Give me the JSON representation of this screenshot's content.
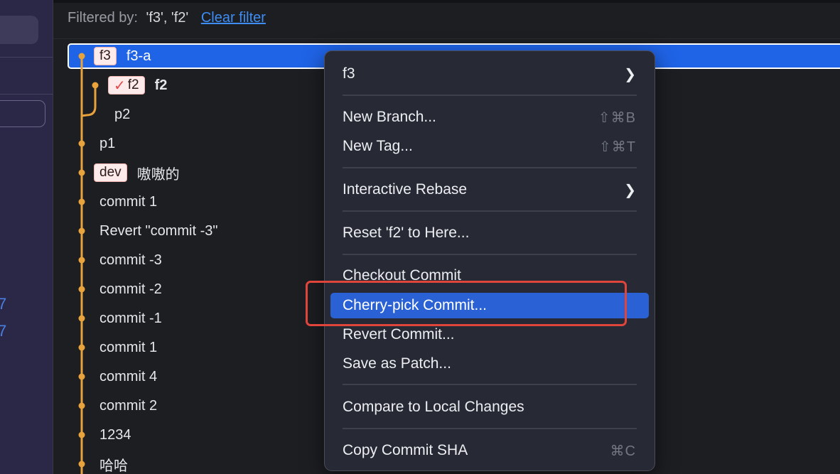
{
  "filter": {
    "label": "Filtered by:",
    "values": "'f3', 'f2'",
    "clear_label": "Clear filter"
  },
  "commits": [
    {
      "tag": "f3",
      "message": "f3-a",
      "selected": true
    },
    {
      "tag": "f2",
      "tag_checked": true,
      "message": "f2",
      "bold": true
    },
    {
      "message": "p2"
    },
    {
      "message": "p1"
    },
    {
      "tag": "dev",
      "message": "嗷嗷的"
    },
    {
      "message": "commit 1"
    },
    {
      "message": "Revert \"commit -3\""
    },
    {
      "message": "commit -3"
    },
    {
      "message": "commit -2"
    },
    {
      "message": "commit -1"
    },
    {
      "message": "commit 1"
    },
    {
      "message": "commit 4"
    },
    {
      "message": "commit 2"
    },
    {
      "message": "1234"
    },
    {
      "message": "哈哈"
    }
  ],
  "sidebar_glyphs": [
    "7",
    "7"
  ],
  "context_menu": {
    "items": [
      {
        "label": "f3",
        "submenu": true
      },
      {
        "label": "New Branch...",
        "shortcut": "⇧⌘B"
      },
      {
        "label": "New Tag...",
        "shortcut": "⇧⌘T"
      },
      {
        "label": "Interactive Rebase",
        "submenu": true
      },
      {
        "label": "Reset 'f2' to Here..."
      },
      {
        "label": "Checkout Commit"
      },
      {
        "label": "Cherry-pick Commit...",
        "highlighted": true
      },
      {
        "label": "Revert Commit..."
      },
      {
        "label": "Save as Patch..."
      },
      {
        "label": "Compare to Local Changes"
      },
      {
        "label": "Copy Commit SHA",
        "shortcut": "⌘C"
      }
    ]
  },
  "colors": {
    "graph_line": "#e8a33c",
    "selection": "#1f63e6",
    "menu_highlight": "#2a62d6",
    "annotation": "#e0453b",
    "link": "#3d8df5"
  },
  "icons": [
    "chevron-right-icon",
    "checkmark-icon",
    "commit-node-icon"
  ]
}
